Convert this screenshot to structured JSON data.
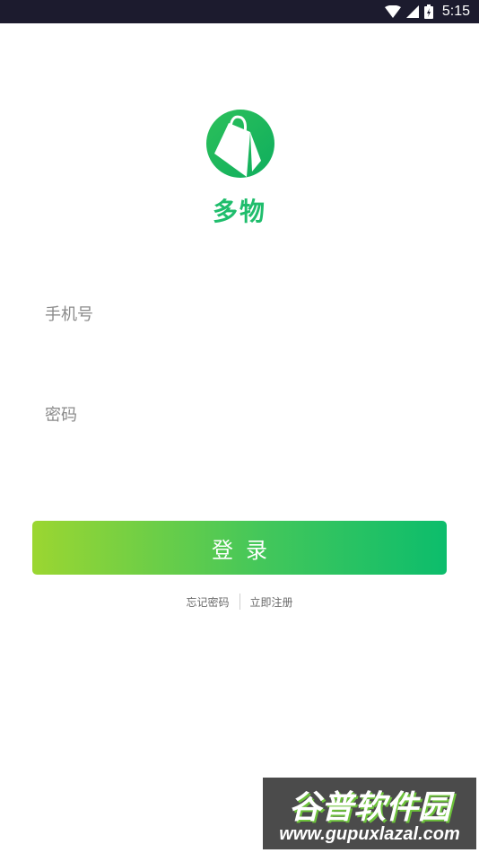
{
  "status_bar": {
    "time": "5:15"
  },
  "app": {
    "name": "多物"
  },
  "form": {
    "phone_placeholder": "手机号",
    "password_placeholder": "密码",
    "login_label": "登录"
  },
  "links": {
    "forgot_password": "忘记密码",
    "register": "立即注册"
  },
  "watermark": {
    "title": "谷普软件园",
    "url": "www.gupuxlazal.com"
  },
  "colors": {
    "brand_green": "#1fbd6c",
    "button_gradient_start": "#9bd631",
    "button_gradient_end": "#0cbd6c"
  }
}
